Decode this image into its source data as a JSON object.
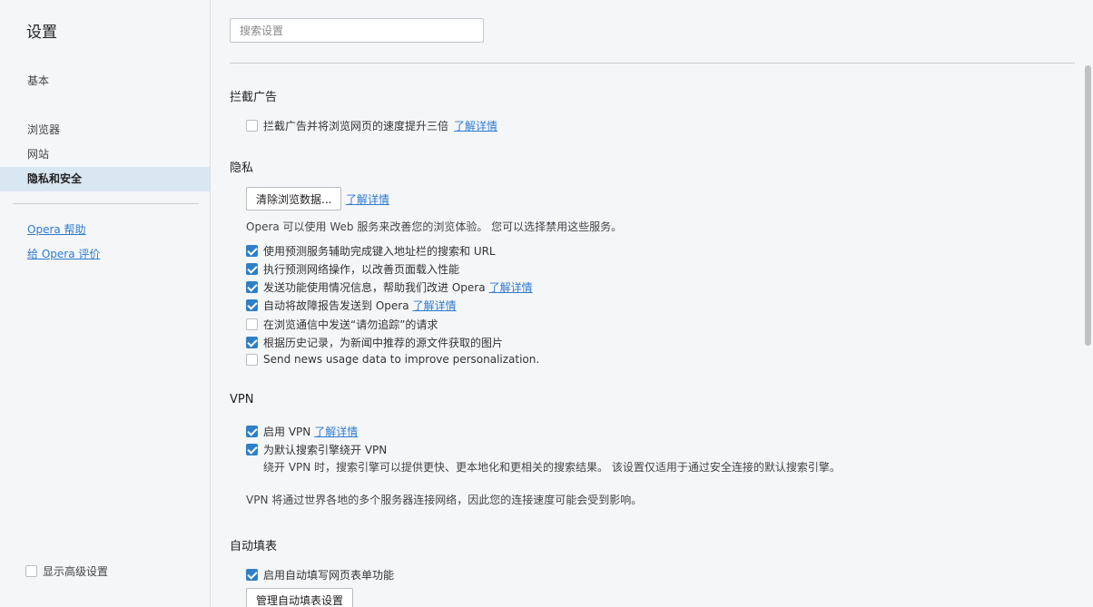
{
  "sidebar": {
    "title": "设置",
    "items": [
      {
        "label": "基本"
      },
      {
        "label": "浏览器"
      },
      {
        "label": "网站"
      },
      {
        "label": "隐私和安全"
      }
    ],
    "links": [
      {
        "label": "Opera 帮助"
      },
      {
        "label": "给 Opera 评价"
      }
    ],
    "advanced_label": "显示高级设置"
  },
  "search": {
    "placeholder": "搜索设置"
  },
  "sections": {
    "adblock": {
      "title": "拦截广告",
      "option_label": "拦截广告并将浏览网页的速度提升三倍",
      "link": "了解详情"
    },
    "privacy": {
      "title": "隐私",
      "clear_button": "清除浏览数据...",
      "clear_link": "了解详情",
      "description": "Opera 可以使用 Web 服务来改善您的浏览体验。 您可以选择禁用这些服务。",
      "options": [
        {
          "label": "使用预测服务辅助完成键入地址栏的搜索和 URL",
          "checked": true
        },
        {
          "label": "执行预测网络操作，以改善页面载入性能",
          "checked": true
        },
        {
          "label": "发送功能使用情况信息，帮助我们改进 Opera",
          "link": "了解详情",
          "checked": true
        },
        {
          "label": "自动将故障报告发送到 Opera",
          "link": "了解详情",
          "checked": true
        },
        {
          "label": "在浏览通信中发送“请勿追踪”的请求",
          "checked": false
        },
        {
          "label": "根据历史记录，为新闻中推荐的源文件获取的图片",
          "checked": true
        },
        {
          "label": "Send news usage data to improve personalization.",
          "checked": false
        }
      ]
    },
    "vpn": {
      "title": "VPN",
      "enable_label": "启用 VPN",
      "enable_link": "了解详情",
      "bypass_label": "为默认搜索引擎绕开 VPN",
      "bypass_note": "绕开 VPN 时，搜索引擎可以提供更快、更本地化和更相关的搜索结果。 该设置仅适用于通过安全连接的默认搜索引擎。",
      "description": "VPN 将通过世界各地的多个服务器连接网络，因此您的连接速度可能会受到影响。"
    },
    "autofill": {
      "title": "自动填表",
      "enable_label": "启用自动填写网页表单功能",
      "manage_button": "管理自动填表设置"
    }
  }
}
